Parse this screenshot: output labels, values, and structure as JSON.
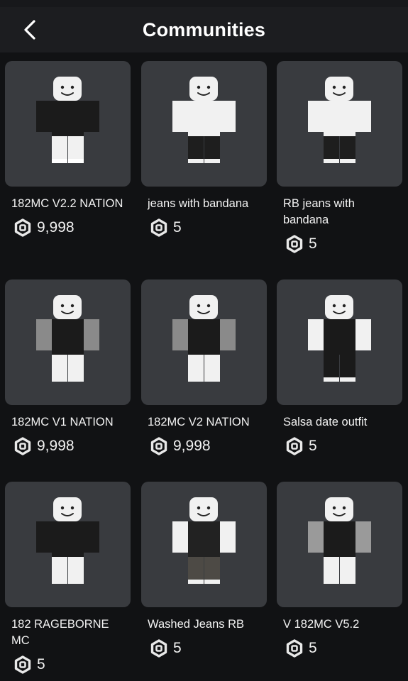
{
  "header": {
    "title": "Communities"
  },
  "items": [
    {
      "name": "182MC V2.2 NATION",
      "price": "9,998",
      "shirt": "#1b1b1b",
      "sleeve": "#1b1b1b",
      "pants": "#f1f1f1",
      "cuff": "#ffffff"
    },
    {
      "name": "jeans with bandana",
      "price": "5",
      "shirt": "#f1f1f1",
      "sleeve": "#f1f1f1",
      "pants": "#1e1e1e",
      "cuff": "#f1f1f1"
    },
    {
      "name": "RB jeans with bandana",
      "price": "5",
      "shirt": "#f1f1f1",
      "sleeve": "#f1f1f1",
      "pants": "#1e1e1e",
      "cuff": "#f1f1f1"
    },
    {
      "name": "182MC V1 NATION",
      "price": "9,998",
      "shirt": "#1b1b1b",
      "sleeve": "#8a8a8a",
      "pants": "#f1f1f1",
      "cuff": "#f1f1f1"
    },
    {
      "name": "182MC V2 NATION",
      "price": "9,998",
      "shirt": "#1b1b1b",
      "sleeve": "#8a8a8a",
      "pants": "#f1f1f1",
      "cuff": "#f1f1f1"
    },
    {
      "name": "Salsa date outfit",
      "price": "5",
      "shirt": "#1a1a1a",
      "sleeve": "#f1f1f1",
      "pants": "#1a1a1a",
      "cuff": "#f1f1f1"
    },
    {
      "name": "182 RAGEBORNE MC",
      "price": "5",
      "shirt": "#1b1b1b",
      "sleeve": "#1b1b1b",
      "pants": "#f1f1f1",
      "cuff": "#f1f1f1"
    },
    {
      "name": "Washed Jeans RB",
      "price": "5",
      "shirt": "#222222",
      "sleeve": "#f1f1f1",
      "pants": "#4d4a45",
      "cuff": "#f1f1f1"
    },
    {
      "name": "V 182MC V5.2",
      "price": "5",
      "shirt": "#1b1b1b",
      "sleeve": "#9a9a9a",
      "pants": "#f1f1f1",
      "cuff": "#f1f1f1"
    }
  ]
}
